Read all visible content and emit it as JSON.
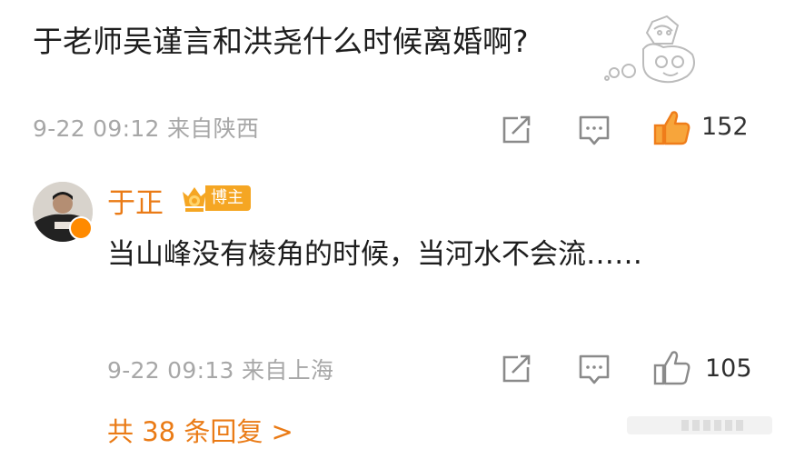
{
  "comment": {
    "text": "于老师吴谨言和洪尧什么时候离婚啊?",
    "meta": "9-22 09:12 来自陕西",
    "like_count": "152",
    "liked": true
  },
  "reply": {
    "author": "于正",
    "author_badge": "博主",
    "text": "当山峰没有棱角的时候，当河水不会流……",
    "meta": "9-22 09:13 来自上海",
    "like_count": "105"
  },
  "more_replies": "共 38 条回复 >",
  "icons": {
    "share": "share-icon",
    "comment": "comment-icon",
    "like": "thumbs-up-icon",
    "vip": "crown-vip-icon"
  },
  "colors": {
    "accent": "#ea7b16",
    "meta": "#a7a7a7",
    "badge": "#f5a623"
  }
}
